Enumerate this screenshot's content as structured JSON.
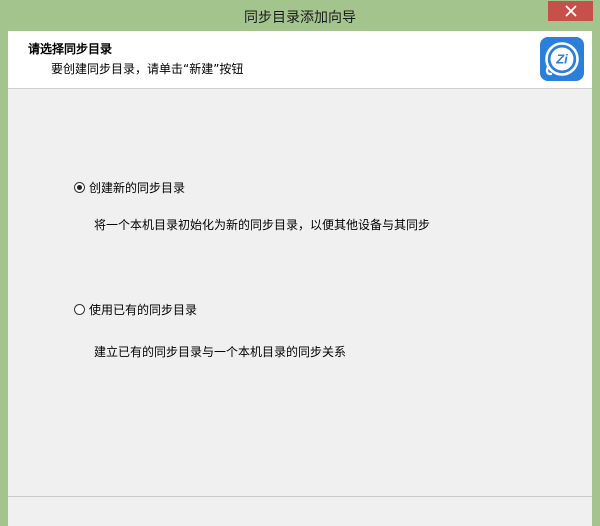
{
  "window": {
    "title": "同步目录添加向导"
  },
  "header": {
    "title": "请选择同步目录",
    "subtitle": "要创建同步目录，请单击“新建”按钮",
    "logo_text": "Zi",
    "logo_icon": "app-logo-icon"
  },
  "options": [
    {
      "label": "创建新的同步目录",
      "description": "将一个本机目录初始化为新的同步目录，以便其他设备与其同步",
      "selected": true
    },
    {
      "label": "使用已有的同步目录",
      "description": "建立已有的同步目录与一个本机目录的同步关系",
      "selected": false
    }
  ],
  "colors": {
    "frame": "#a4c48e",
    "close_button": "#c7504a",
    "client_background": "#f0f0f0",
    "header_background": "#ffffff",
    "logo_blue": "#2b7fd8"
  }
}
